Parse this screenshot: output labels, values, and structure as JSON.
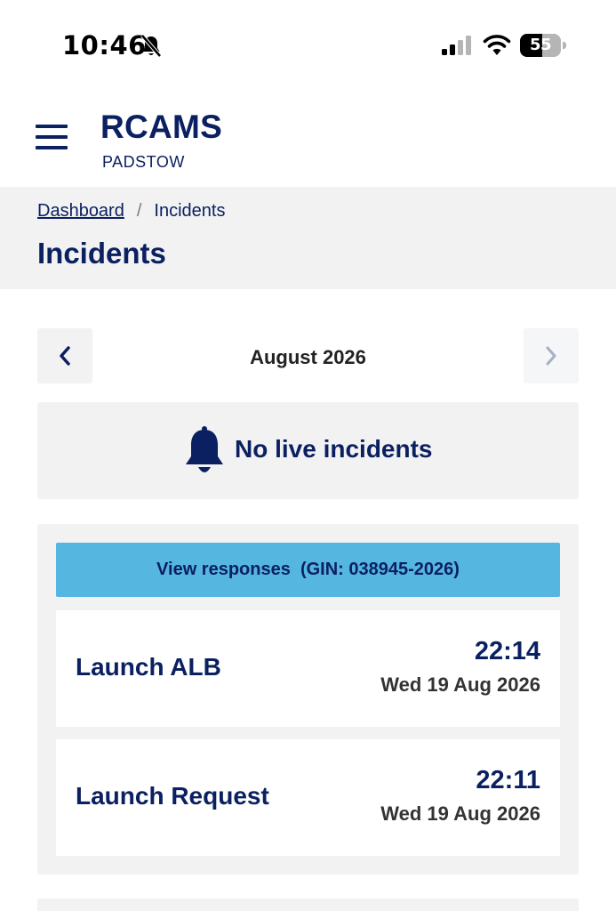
{
  "status_bar": {
    "time": "10:46",
    "battery_percent": "55",
    "battery_level": 0.55,
    "icons": [
      "bell-slash-icon",
      "cellular-signal-icon",
      "wifi-icon",
      "battery-icon"
    ]
  },
  "header": {
    "menu_icon": "hamburger-menu-icon",
    "brand": "RCAMS",
    "station": "PADSTOW"
  },
  "breadcrumb": {
    "items": [
      {
        "label": "Dashboard",
        "link": true
      },
      {
        "label": "Incidents",
        "link": false
      }
    ],
    "separator": "/"
  },
  "page": {
    "title": "Incidents"
  },
  "month_nav": {
    "label": "August 2026",
    "prev_icon": "chevron-left-icon",
    "next_icon": "chevron-right-icon",
    "next_disabled": true
  },
  "live": {
    "icon": "bell-icon",
    "text": "No live incidents"
  },
  "incident_group": {
    "view_responses_label": "View responses  (GIN: 038945-2026)",
    "incidents": [
      {
        "name": "Launch ALB",
        "time": "22:14",
        "date": "Wed 19 Aug 2026"
      },
      {
        "name": "Launch Request",
        "time": "22:11",
        "date": "Wed 19 Aug 2026"
      }
    ]
  },
  "colors": {
    "navy": "#0b2060",
    "panel_gray": "#f2f2f2",
    "accent_blue": "#55b6e0"
  }
}
